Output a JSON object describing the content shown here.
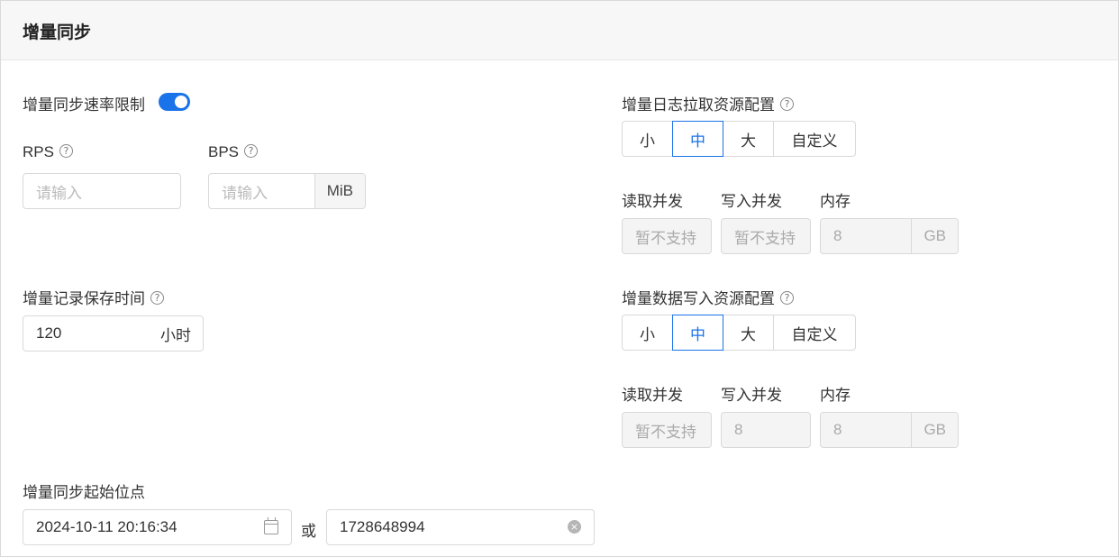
{
  "section": {
    "title": "增量同步"
  },
  "rate_limit": {
    "label": "增量同步速率限制",
    "enabled": true,
    "rps": {
      "label": "RPS",
      "placeholder": "请输入"
    },
    "bps": {
      "label": "BPS",
      "placeholder": "请输入",
      "unit": "MiB"
    }
  },
  "retention": {
    "label": "增量记录保存时间",
    "value": "120",
    "unit": "小时"
  },
  "start_point": {
    "label": "增量同步起始位点",
    "datetime": "2024-10-11 20:16:34",
    "or_label": "或",
    "timestamp": "1728648994"
  },
  "log_fetch": {
    "label": "增量日志拉取资源配置",
    "options": [
      "小",
      "中",
      "大",
      "自定义"
    ],
    "selected": "中",
    "read_concurrency": {
      "label": "读取并发",
      "value": "暂不支持"
    },
    "write_concurrency": {
      "label": "写入并发",
      "value": "暂不支持"
    },
    "memory": {
      "label": "内存",
      "value": "8",
      "unit": "GB"
    }
  },
  "data_write": {
    "label": "增量数据写入资源配置",
    "options": [
      "小",
      "中",
      "大",
      "自定义"
    ],
    "selected": "中",
    "read_concurrency": {
      "label": "读取并发",
      "value": "暂不支持"
    },
    "write_concurrency": {
      "label": "写入并发",
      "value": "8"
    },
    "memory": {
      "label": "内存",
      "value": "8",
      "unit": "GB"
    }
  },
  "icons": {
    "help": "?",
    "clear": "×"
  },
  "colors": {
    "accent": "#1a73e8",
    "header_bg": "#f7f7f7",
    "border": "#d9d9d9",
    "disabled_bg": "#f4f4f4"
  }
}
